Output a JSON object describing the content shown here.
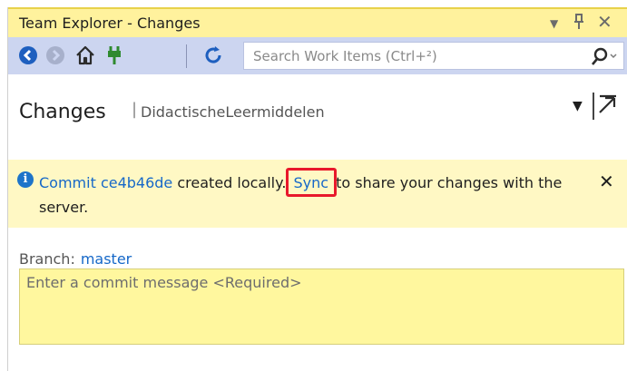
{
  "window": {
    "title": "Team Explorer - Changes",
    "dropdown_icon": "chevron-down",
    "pin_icon": "pin",
    "close_icon": "close"
  },
  "toolbar": {
    "icons": [
      "back-icon",
      "forward-icon",
      "home-icon",
      "connect-icon",
      "refresh-icon"
    ],
    "search_placeholder": "Search Work Items (Ctrl+²)"
  },
  "header": {
    "title": "Changes",
    "separator": "|",
    "repository": "DidactischeLeermiddelen"
  },
  "notification": {
    "link_text": "Commit ce4b46de",
    "text_mid": " created locally.",
    "sync_link": "Sync",
    "text_end": " to share your changes with the server.",
    "dismiss": "✕"
  },
  "branch": {
    "label": "Branch:",
    "value": "master"
  },
  "commit": {
    "placeholder": "Enter a commit message <Required>"
  },
  "colors": {
    "titlebar": "#fff29d",
    "toolbar": "#ccd5f0",
    "notice_bg": "#fff8c4",
    "commit_bg": "#fff79e",
    "link": "#1668c8",
    "highlight": "#e8192c"
  }
}
